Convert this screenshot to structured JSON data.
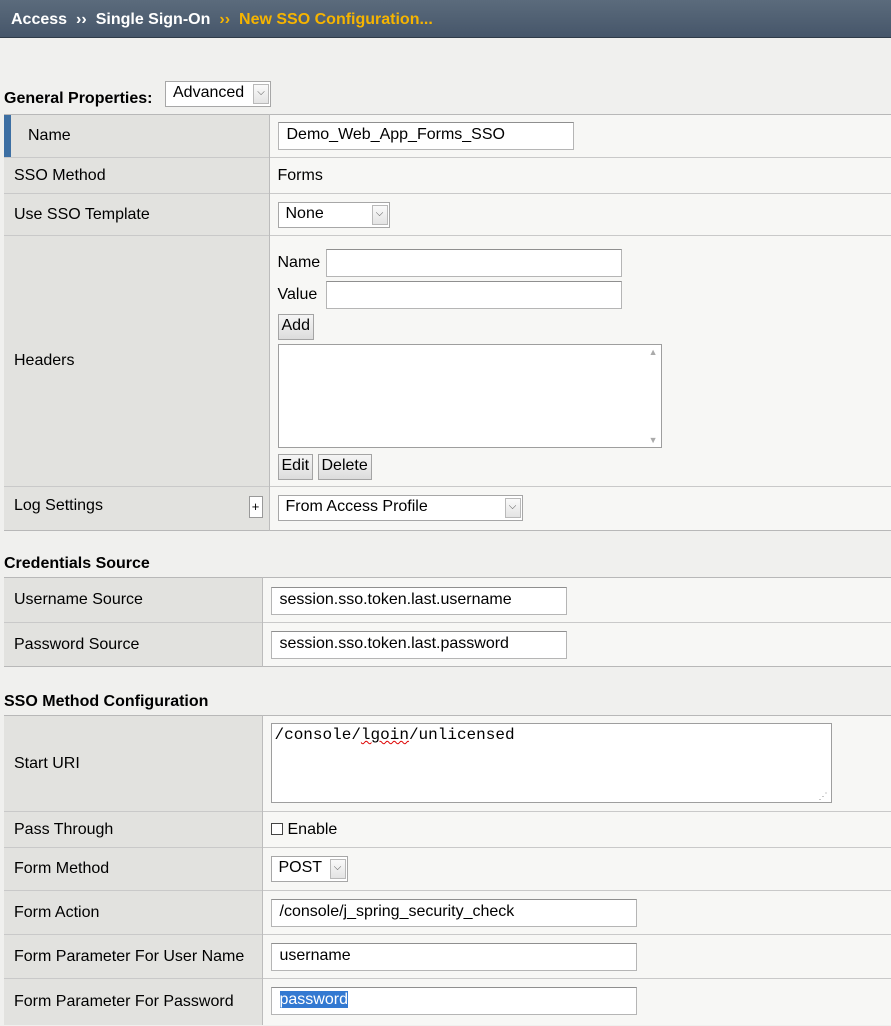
{
  "breadcrumb": {
    "items": [
      "Access",
      "Single Sign-On"
    ],
    "current": "New SSO Configuration...",
    "separator": "››"
  },
  "general": {
    "title": "General Properties:",
    "mode": "Advanced",
    "name_label": "Name",
    "name_value": "Demo_Web_App_Forms_SSO",
    "sso_method_label": "SSO Method",
    "sso_method_value": "Forms",
    "template_label": "Use SSO Template",
    "template_value": "None",
    "headers_label": "Headers",
    "header_name_label": "Name",
    "header_name_value": "",
    "header_value_label": "Value",
    "header_value_value": "",
    "add_button": "Add",
    "edit_button": "Edit",
    "delete_button": "Delete",
    "log_label": "Log Settings",
    "log_plus": "+",
    "log_value": "From Access Profile"
  },
  "credentials": {
    "title": "Credentials Source",
    "username_label": "Username Source",
    "username_value": "session.sso.token.last.username",
    "password_label": "Password Source",
    "password_value": "session.sso.token.last.password"
  },
  "method_config": {
    "title": "SSO Method Configuration",
    "start_uri_label": "Start URI",
    "start_uri_prefix": "/console/",
    "start_uri_misspelled": "lgoin",
    "start_uri_suffix": "/unlicensed",
    "pass_through_label": "Pass Through",
    "pass_through_option": "Enable",
    "pass_through_checked": false,
    "form_method_label": "Form Method",
    "form_method_value": "POST",
    "form_action_label": "Form Action",
    "form_action_value": "/console/j_spring_security_check",
    "param_user_label": "Form Parameter For User Name",
    "param_user_value": "username",
    "param_pass_label": "Form Parameter For Password",
    "param_pass_value": "password"
  },
  "colors": {
    "accent": "#3d6fa3",
    "breadcrumb_current": "#f6b400",
    "selection": "#3379d1"
  }
}
